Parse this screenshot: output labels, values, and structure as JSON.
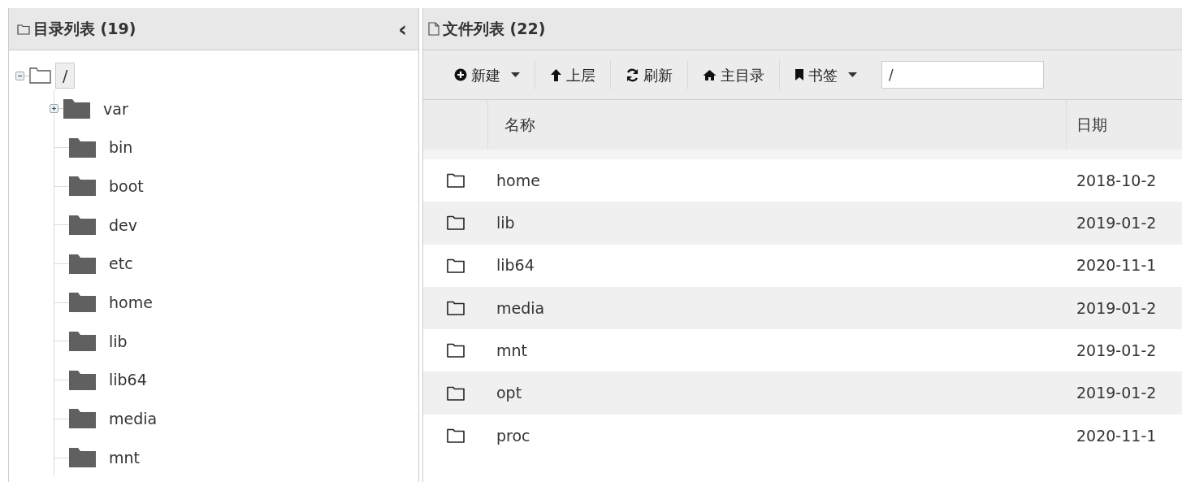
{
  "dir_panel": {
    "title": "目录列表 (19)",
    "collapse_glyph": "‹"
  },
  "tree": {
    "label": "/",
    "expanded": true,
    "selected": true,
    "children": [
      {
        "label": "var",
        "expanded": false,
        "has_children": true
      },
      {
        "label": "bin",
        "has_children": false
      },
      {
        "label": "boot",
        "has_children": false
      },
      {
        "label": "dev",
        "has_children": false
      },
      {
        "label": "etc",
        "has_children": false
      },
      {
        "label": "home",
        "has_children": false
      },
      {
        "label": "lib",
        "has_children": false
      },
      {
        "label": "lib64",
        "has_children": false
      },
      {
        "label": "media",
        "has_children": false
      },
      {
        "label": "mnt",
        "has_children": false
      }
    ]
  },
  "file_panel": {
    "title": "文件列表 (22)"
  },
  "toolbar": [
    {
      "kind": "new",
      "label": "新建",
      "dropdown": true
    },
    {
      "kind": "up",
      "label": "上层",
      "dropdown": false
    },
    {
      "kind": "refresh",
      "label": "刷新",
      "dropdown": false
    },
    {
      "kind": "home",
      "label": "主目录",
      "dropdown": false
    },
    {
      "kind": "bookmark",
      "label": "书签",
      "dropdown": true
    }
  ],
  "path_field": {
    "value": "/"
  },
  "table": {
    "columns": [
      "名称",
      "日期"
    ],
    "rows": [
      {
        "name": "home",
        "date": "2018-10-2"
      },
      {
        "name": "lib",
        "date": "2019-01-2"
      },
      {
        "name": "lib64",
        "date": "2020-11-1"
      },
      {
        "name": "media",
        "date": "2019-01-2"
      },
      {
        "name": "mnt",
        "date": "2019-01-2"
      },
      {
        "name": "opt",
        "date": "2019-01-2"
      },
      {
        "name": "proc",
        "date": "2020-11-1"
      }
    ]
  }
}
